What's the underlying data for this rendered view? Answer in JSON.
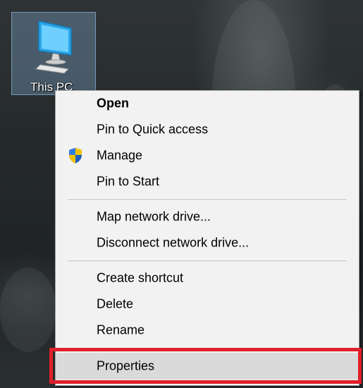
{
  "desktop": {
    "icon": {
      "label": "This PC",
      "icon": "computer-monitor-icon"
    }
  },
  "context_menu": {
    "groups": [
      [
        {
          "label": "Open",
          "bold": true
        },
        {
          "label": "Pin to Quick access"
        },
        {
          "label": "Manage",
          "icon": "uac-shield-icon"
        },
        {
          "label": "Pin to Start"
        }
      ],
      [
        {
          "label": "Map network drive..."
        },
        {
          "label": "Disconnect network drive..."
        }
      ],
      [
        {
          "label": "Create shortcut"
        },
        {
          "label": "Delete"
        },
        {
          "label": "Rename"
        }
      ],
      [
        {
          "label": "Properties",
          "highlighted": true
        }
      ]
    ]
  },
  "colors": {
    "highlight_outline": "#e0202a",
    "menu_background": "#f2f2f2",
    "hover_background": "#dadada"
  }
}
